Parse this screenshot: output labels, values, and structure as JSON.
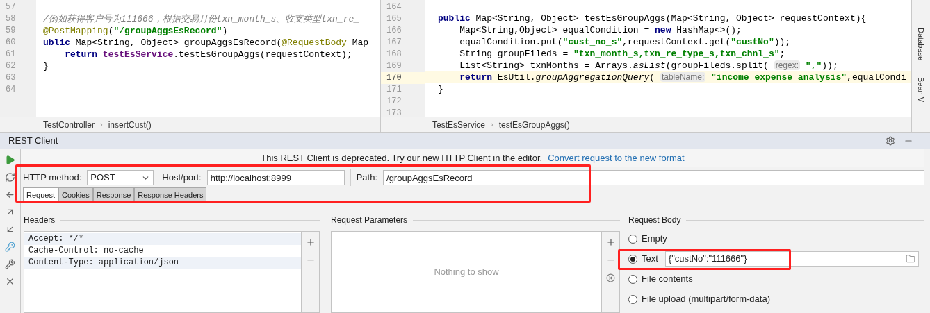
{
  "editors": [
    {
      "lines": [
        {
          "number": "57",
          "current": false
        },
        {
          "number": "58",
          "current": false,
          "tokens": [
            {
              "kind": "comment",
              "t": "/例如获得客户号为111666，根据交易月份txn_month_s、收支类型txn_re_"
            }
          ]
        },
        {
          "number": "59",
          "current": false,
          "tokens": [
            {
              "kind": "annotation",
              "t": "@PostMapping"
            },
            {
              "kind": "plain",
              "t": "("
            },
            {
              "kind": "string",
              "t": "\"/groupAggsEsRecord\""
            },
            {
              "kind": "plain",
              "t": ")"
            }
          ]
        },
        {
          "number": "60",
          "current": false,
          "tokens": [
            {
              "kind": "keyword",
              "t": "ublic "
            },
            {
              "kind": "plain",
              "t": "Map<String, Object> groupAggsEsRecord("
            },
            {
              "kind": "annotation",
              "t": "@RequestBody"
            },
            {
              "kind": "plain",
              "t": " Map"
            }
          ]
        },
        {
          "number": "61",
          "current": false,
          "tokens": [
            {
              "kind": "keyword",
              "t": "    return "
            },
            {
              "kind": "field",
              "t": "testEsService"
            },
            {
              "kind": "plain",
              "t": ".testEsGroupAggs(requestContext);"
            }
          ]
        },
        {
          "number": "62",
          "current": false,
          "tokens": [
            {
              "kind": "plain",
              "t": "}"
            }
          ]
        },
        {
          "number": "63",
          "current": false
        },
        {
          "number": "64",
          "current": false
        }
      ],
      "breadcrumb": [
        "TestController",
        "insertCust()"
      ],
      "separator": "›"
    },
    {
      "lines": [
        {
          "number": "164",
          "current": false
        },
        {
          "number": "165",
          "current": false,
          "tokens": [
            {
              "kind": "keyword",
              "t": "public "
            },
            {
              "kind": "plain",
              "t": "Map<String, Object> testEsGroupAggs(Map<String, Object> requestContext){"
            }
          ]
        },
        {
          "number": "166",
          "current": false,
          "tokens": [
            {
              "kind": "plain",
              "t": "    Map<String,Object> equalCondition = "
            },
            {
              "kind": "keyword",
              "t": "new "
            },
            {
              "kind": "plain",
              "t": "HashMap<>();"
            }
          ]
        },
        {
          "number": "167",
          "current": false,
          "tokens": [
            {
              "kind": "plain",
              "t": "    equalCondition.put("
            },
            {
              "kind": "string",
              "t": "\"cust_no_s\""
            },
            {
              "kind": "plain",
              "t": ",requestContext.get("
            },
            {
              "kind": "string",
              "t": "\"custNo\""
            },
            {
              "kind": "plain",
              "t": "));"
            }
          ]
        },
        {
          "number": "168",
          "current": false,
          "tokens": [
            {
              "kind": "plain",
              "t": "    String groupFileds = "
            },
            {
              "kind": "string",
              "t": "\"txn_month_s,txn_re_type_s,txn_chnl_s\""
            },
            {
              "kind": "plain",
              "t": ";"
            }
          ]
        },
        {
          "number": "169",
          "current": false,
          "tokens": [
            {
              "kind": "plain",
              "t": "    List<String> txnMonths = Arrays."
            },
            {
              "kind": "static",
              "t": "asList"
            },
            {
              "kind": "plain",
              "t": "(groupFileds.split( "
            },
            {
              "kind": "hint",
              "t": "regex:"
            },
            {
              "kind": "string",
              "t": " \",\""
            },
            {
              "kind": "plain",
              "t": "));"
            }
          ]
        },
        {
          "number": "170",
          "current": true,
          "tokens": [
            {
              "kind": "keyword",
              "t": "    return "
            },
            {
              "kind": "plain",
              "t": "EsUtil."
            },
            {
              "kind": "static",
              "t": "groupAggregationQuery"
            },
            {
              "kind": "plain",
              "t": "( "
            },
            {
              "kind": "hint",
              "t": "tableName:"
            },
            {
              "kind": "string",
              "t": " \"income_expense_analysis\""
            },
            {
              "kind": "plain",
              "t": ",equalCondi"
            }
          ]
        },
        {
          "number": "171",
          "current": false,
          "tokens": [
            {
              "kind": "plain",
              "t": "}"
            }
          ]
        },
        {
          "number": "172",
          "current": false
        },
        {
          "number": "173",
          "current": false
        }
      ],
      "breadcrumb": [
        "TestEsService",
        "testEsGroupAggs()"
      ],
      "separator": "›"
    }
  ],
  "side_tabs": [
    "Database",
    "Bean V"
  ],
  "rest_client": {
    "title": "REST Client",
    "notice": "This REST Client is deprecated. Try our new HTTP Client in the editor.",
    "notice_link": "Convert request to the new format",
    "method_label": "HTTP method:",
    "method": "POST",
    "host_label": "Host/port:",
    "host": "http://localhost:8999",
    "path_label": "Path:",
    "path": "/groupAggsEsRecord",
    "tabs": [
      {
        "label": "Request",
        "selected": true
      },
      {
        "label": "Cookies",
        "selected": false
      },
      {
        "label": "Response",
        "selected": false
      },
      {
        "label": "Response Headers",
        "selected": false
      }
    ],
    "headers_title": "Headers",
    "headers": [
      "Accept: */*",
      "Cache-Control: no-cache",
      "Content-Type: application/json"
    ],
    "params_title": "Request Parameters",
    "params_empty": "Nothing to show",
    "body_title": "Request Body",
    "body_options": [
      {
        "kind": "radio",
        "label": "Empty",
        "selected": false
      },
      {
        "kind": "text",
        "label": "Text",
        "selected": true,
        "value": "{\"custNo\":\"111666\"}"
      },
      {
        "kind": "radio",
        "label": "File contents",
        "selected": false
      },
      {
        "kind": "radio",
        "label": "File upload (multipart/form-data)",
        "selected": false
      }
    ]
  }
}
